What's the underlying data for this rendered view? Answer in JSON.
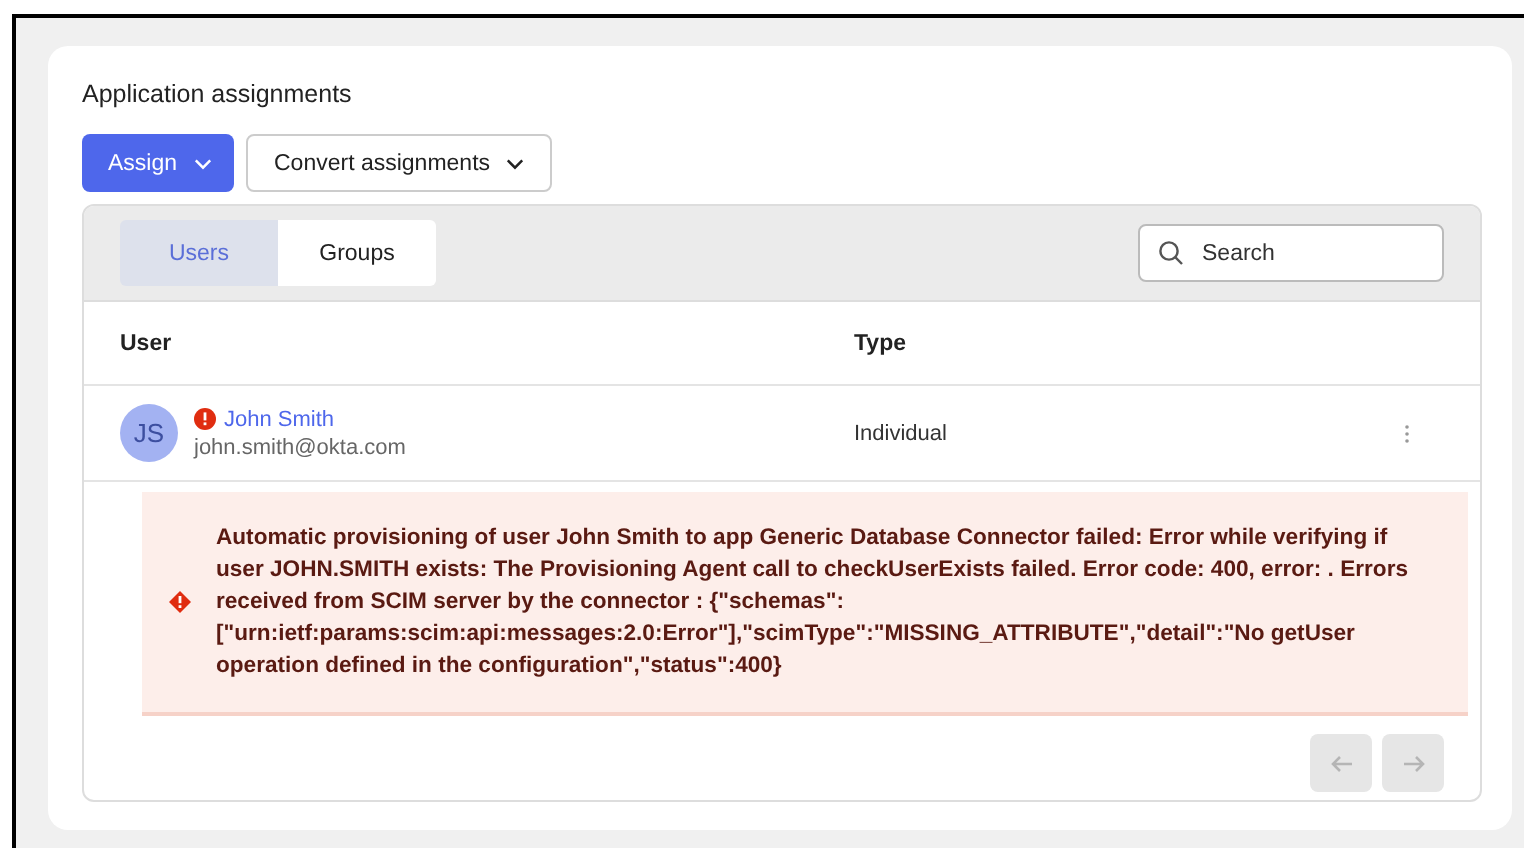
{
  "section": {
    "title": "Application assignments"
  },
  "actions": [
    {
      "label": "Assign",
      "kind": "primary"
    },
    {
      "label": "Convert assignments",
      "kind": "secondary"
    }
  ],
  "tabs": [
    {
      "label": "Users",
      "selected": true
    },
    {
      "label": "Groups",
      "selected": false
    }
  ],
  "search": {
    "placeholder": "Search"
  },
  "table": {
    "columns": [
      "User",
      "Type"
    ],
    "rows": [
      {
        "initials": "JS",
        "name": "John Smith",
        "email": "john.smith@okta.com",
        "type": "Individual",
        "has_error": true,
        "error": "Automatic provisioning of user John Smith to app Generic Database Connector failed: Error while verifying if user JOHN.SMITH exists: The Provisioning Agent call to checkUserExists failed. Error code: 400, error: . Errors received from SCIM server by the connector : {\"schemas\":[\"urn:ietf:params:scim:api:messages:2.0:Error\"],\"scimType\":\"MISSING_ATTRIBUTE\",\"detail\":\"No getUser operation defined in the configuration\",\"status\":400}"
      }
    ]
  },
  "pagination": {
    "previous_disabled": true,
    "next_disabled": true
  }
}
